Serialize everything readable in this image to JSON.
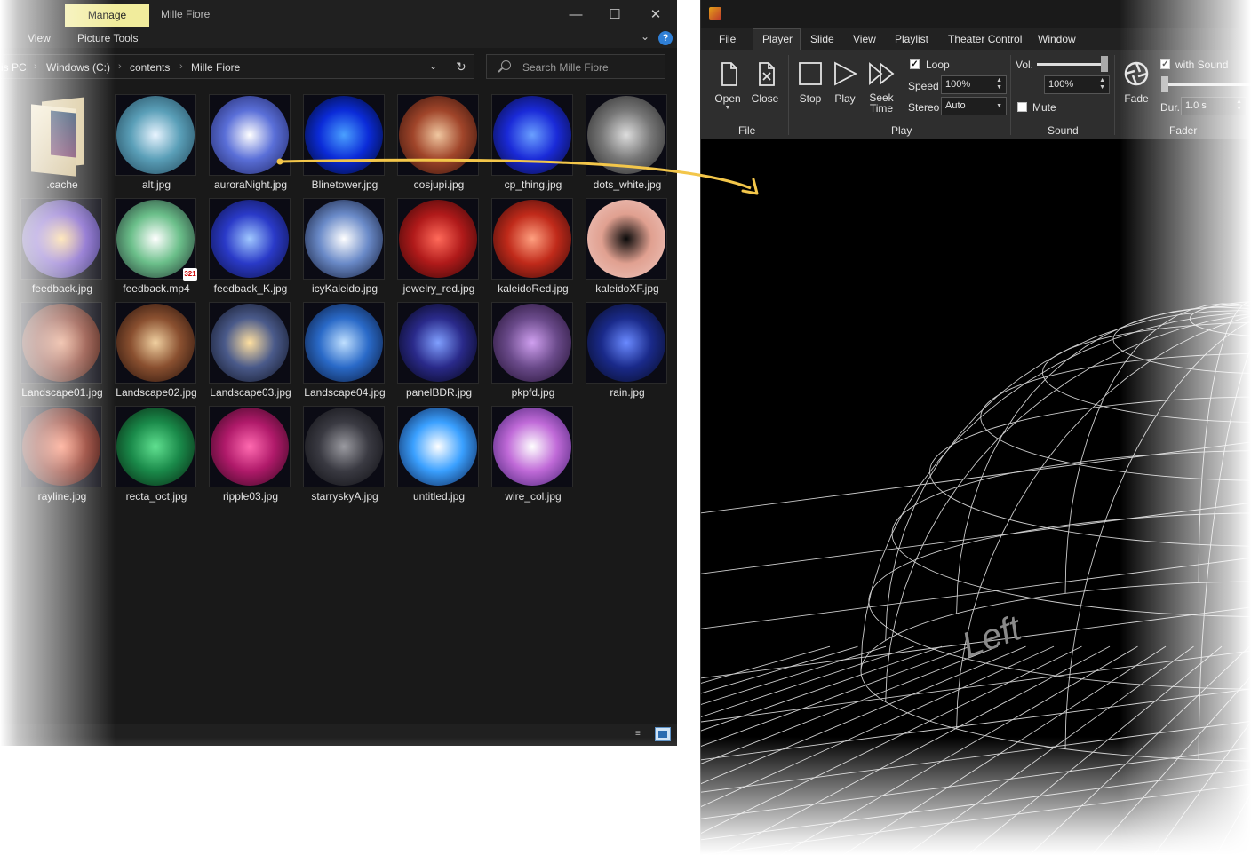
{
  "explorer": {
    "manage_tab": "Manage",
    "title": "Mille Fiore",
    "ribbon_tabs": [
      "View",
      "Picture Tools"
    ],
    "address": {
      "crumbs": [
        "is PC",
        "Windows (C:)",
        "contents",
        "Mille Fiore"
      ]
    },
    "search": {
      "placeholder": "Search Mille Fiore"
    },
    "files": [
      {
        "name": ".cache",
        "kind": "folder"
      },
      {
        "name": "alt.jpg",
        "colors": [
          "#e8f4ff",
          "#5a9fb8",
          "#1c3d4f"
        ]
      },
      {
        "name": "auroraNight.jpg",
        "colors": [
          "#ffffff",
          "#5a6fd8",
          "#1b1f5a"
        ]
      },
      {
        "name": "Blinetower.jpg",
        "colors": [
          "#4aa0ff",
          "#0b2bd8",
          "#000514"
        ]
      },
      {
        "name": "cosjupi.jpg",
        "colors": [
          "#f0c7a0",
          "#a0452a",
          "#2a0d08"
        ]
      },
      {
        "name": "cp_thing.jpg",
        "colors": [
          "#6aa0ff",
          "#1a2ad8",
          "#06082a"
        ]
      },
      {
        "name": "dots_white.jpg",
        "colors": [
          "#dddddd",
          "#777777",
          "#222222"
        ]
      },
      {
        "name": "feedback.jpg",
        "colors": [
          "#ffd890",
          "#7a5ac8",
          "#2a2a5a"
        ]
      },
      {
        "name": "feedback.mp4",
        "colors": [
          "#ffffff",
          "#6bbf8a",
          "#1b2a2a"
        ],
        "badge": "321"
      },
      {
        "name": "feedback_K.jpg",
        "colors": [
          "#a0c8ff",
          "#2a3ac8",
          "#0a0d3a"
        ]
      },
      {
        "name": "icyKaleido.jpg",
        "colors": [
          "#ffffff",
          "#6a8ac8",
          "#0a1028"
        ]
      },
      {
        "name": "jewelry_red.jpg",
        "colors": [
          "#ff6a5a",
          "#b01a1a",
          "#2a0505"
        ]
      },
      {
        "name": "kaleidoRed.jpg",
        "colors": [
          "#ffa080",
          "#c02a1a",
          "#300808"
        ]
      },
      {
        "name": "kaleidoXF.jpg",
        "colors": [
          "#0a0a0a",
          "#e0a090",
          "#f0c8c0"
        ]
      },
      {
        "name": "Landscape01.jpg",
        "colors": [
          "#e8a080",
          "#8a4030",
          "#2a1008"
        ]
      },
      {
        "name": "Landscape02.jpg",
        "colors": [
          "#f0d0a0",
          "#8a5030",
          "#1a0a06"
        ]
      },
      {
        "name": "Landscape03.jpg",
        "colors": [
          "#ffe0a0",
          "#4a5a8a",
          "#0a0d1a"
        ]
      },
      {
        "name": "Landscape04.jpg",
        "colors": [
          "#c0e0ff",
          "#2a6ac8",
          "#06102a"
        ]
      },
      {
        "name": "panelBDR.jpg",
        "colors": [
          "#80a0ff",
          "#2a2a8a",
          "#000008"
        ]
      },
      {
        "name": "pkpfd.jpg",
        "colors": [
          "#d0a0f0",
          "#6a4a8a",
          "#1a0a28"
        ]
      },
      {
        "name": "rain.jpg",
        "colors": [
          "#6a8aff",
          "#1a2a8a",
          "#050818"
        ]
      },
      {
        "name": "rayline.jpg",
        "colors": [
          "#ff8a6a",
          "#8a2a1a",
          "#1a0505"
        ]
      },
      {
        "name": "recta_oct.jpg",
        "colors": [
          "#60e090",
          "#1a8a4a",
          "#051a0a"
        ]
      },
      {
        "name": "ripple03.jpg",
        "colors": [
          "#ff6ab0",
          "#b01a6a",
          "#2a0518"
        ]
      },
      {
        "name": "starryskyA.jpg",
        "colors": [
          "#9a9aa0",
          "#3a3a42",
          "#0a0a0e"
        ]
      },
      {
        "name": "untitled.jpg",
        "colors": [
          "#ffffff",
          "#3aa0ff",
          "#06123a"
        ]
      },
      {
        "name": "wire_col.jpg",
        "colors": [
          "#ffffff",
          "#c06ad8",
          "#3a1a6a"
        ]
      }
    ]
  },
  "player": {
    "menu": [
      "File",
      "Player",
      "Slide",
      "View",
      "Playlist",
      "Theater Control",
      "Window"
    ],
    "active_menu": "Player",
    "file_group": {
      "open": "Open",
      "close": "Close",
      "label": "File"
    },
    "play_group": {
      "stop": "Stop",
      "play": "Play",
      "seek_line1": "Seek",
      "seek_line2": "Time",
      "loop": "Loop",
      "loop_checked": true,
      "speed_label": "Speed",
      "speed_value": "100%",
      "stereo_label": "Stereo",
      "stereo_value": "Auto",
      "label": "Play"
    },
    "sound_group": {
      "vol_label": "Vol.",
      "vol_value": "100%",
      "vol_level": 1.0,
      "mute": "Mute",
      "mute_checked": false,
      "label": "Sound"
    },
    "fader_group": {
      "fade": "Fade",
      "with_sound": "with Sound",
      "with_sound_checked": true,
      "dur_label": "Dur.",
      "dur_value": "1.0 s",
      "label": "Fader"
    },
    "viewport_text": "Left"
  },
  "colors": {
    "accent_yellow": "#f3c64a",
    "manage_tab": "#f1ec9c",
    "help_blue": "#2f7fd6"
  }
}
